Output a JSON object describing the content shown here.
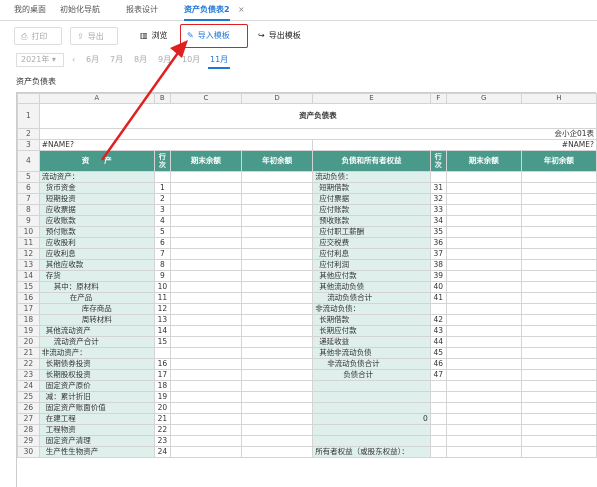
{
  "tabs": [
    {
      "label": "我的桌面"
    },
    {
      "label": "初始化导航"
    },
    {
      "label": "报表设计"
    },
    {
      "label": "资产负债表2"
    }
  ],
  "tab_close_glyph": "×",
  "toolbar": {
    "print": "打印",
    "export": "导出",
    "browse": "浏览",
    "import_template": "导入模板",
    "export_template": "导出模板"
  },
  "period": {
    "year": "2021年",
    "year_arrow": "▾",
    "prev": "‹",
    "months": [
      "6月",
      "7月",
      "8月",
      "9月",
      "10月",
      "11月"
    ],
    "active_month": "11月"
  },
  "sheet_name": "资产负债表",
  "columns": [
    "A",
    "B",
    "C",
    "D",
    "E",
    "F",
    "G",
    "H"
  ],
  "sheet": {
    "title": "资产负债表",
    "unit": "会小企01表",
    "ref_left": "#NAME?",
    "ref_right": "#NAME?",
    "headers": {
      "asset": "资　　产",
      "line_no": "行次",
      "end_balance": "期末余额",
      "begin_balance": "年初余额",
      "liab": "负债和所有者权益",
      "line_no2": "行次",
      "end_balance2": "期末余额",
      "begin_balance2": "年初余额"
    },
    "rows": [
      {
        "n": "5",
        "a": "流动资产：",
        "ai": 0,
        "b": "",
        "e": "流动负债：",
        "ei": 0,
        "f": ""
      },
      {
        "n": "6",
        "a": "货币资金",
        "ai": 1,
        "b": "1",
        "e": "短期借款",
        "ei": 1,
        "f": "31"
      },
      {
        "n": "7",
        "a": "短期投资",
        "ai": 1,
        "b": "2",
        "e": "应付票据",
        "ei": 1,
        "f": "32"
      },
      {
        "n": "8",
        "a": "应收票据",
        "ai": 1,
        "b": "3",
        "e": "应付账款",
        "ei": 1,
        "f": "33"
      },
      {
        "n": "9",
        "a": "应收账款",
        "ai": 1,
        "b": "4",
        "e": "预收账款",
        "ei": 1,
        "f": "34"
      },
      {
        "n": "10",
        "a": "预付账款",
        "ai": 1,
        "b": "5",
        "e": "应付职工薪酬",
        "ei": 1,
        "f": "35"
      },
      {
        "n": "11",
        "a": "应收股利",
        "ai": 1,
        "b": "6",
        "e": "应交税费",
        "ei": 1,
        "f": "36"
      },
      {
        "n": "12",
        "a": "应收利息",
        "ai": 1,
        "b": "7",
        "e": "应付利息",
        "ei": 1,
        "f": "37"
      },
      {
        "n": "13",
        "a": "其他应收款",
        "ai": 1,
        "b": "8",
        "e": "应付利润",
        "ei": 1,
        "f": "38"
      },
      {
        "n": "14",
        "a": "存货",
        "ai": 1,
        "b": "9",
        "e": "其他应付款",
        "ei": 1,
        "f": "39"
      },
      {
        "n": "15",
        "a": "其中：原材料",
        "ai": 2,
        "b": "10",
        "e": "其他流动负债",
        "ei": 1,
        "f": "40"
      },
      {
        "n": "16",
        "a": "在产品",
        "ai": 3,
        "b": "11",
        "e": "流动负债合计",
        "ei": 2,
        "f": "41"
      },
      {
        "n": "17",
        "a": "库存商品",
        "ai": 4,
        "b": "12",
        "e": "非流动负债：",
        "ei": 0,
        "f": ""
      },
      {
        "n": "18",
        "a": "周转材料",
        "ai": 4,
        "b": "13",
        "e": "长期借款",
        "ei": 1,
        "f": "42"
      },
      {
        "n": "19",
        "a": "其他流动资产",
        "ai": 1,
        "b": "14",
        "e": "长期应付款",
        "ei": 1,
        "f": "43"
      },
      {
        "n": "20",
        "a": "流动资产合计",
        "ai": 2,
        "b": "15",
        "e": "递延收益",
        "ei": 1,
        "f": "44"
      },
      {
        "n": "21",
        "a": "非流动资产：",
        "ai": 0,
        "b": "",
        "e": "其他非流动负债",
        "ei": 1,
        "f": "45"
      },
      {
        "n": "22",
        "a": "长期债券投资",
        "ai": 1,
        "b": "16",
        "e": "非流动负债合计",
        "ei": 2,
        "f": "46"
      },
      {
        "n": "23",
        "a": "长期股权投资",
        "ai": 1,
        "b": "17",
        "e": "负债合计",
        "ei": 3,
        "f": "47"
      },
      {
        "n": "24",
        "a": "固定资产原价",
        "ai": 1,
        "b": "18",
        "e": "",
        "ei": 0,
        "f": ""
      },
      {
        "n": "25",
        "a": "减：累计折旧",
        "ai": 1,
        "b": "19",
        "e": "",
        "ei": 0,
        "f": ""
      },
      {
        "n": "26",
        "a": "固定资产账面价值",
        "ai": 1,
        "b": "20",
        "e": "",
        "ei": 0,
        "f": ""
      },
      {
        "n": "27",
        "a": "在建工程",
        "ai": 1,
        "b": "21",
        "e": "",
        "ei": 0,
        "f": "",
        "e_val": "0"
      },
      {
        "n": "28",
        "a": "工程物资",
        "ai": 1,
        "b": "22",
        "e": "",
        "ei": 0,
        "f": ""
      },
      {
        "n": "29",
        "a": "固定资产清理",
        "ai": 1,
        "b": "23",
        "e": "",
        "ei": 0,
        "f": ""
      },
      {
        "n": "30",
        "a": "生产性生物资产",
        "ai": 1,
        "b": "24",
        "e": "所有者权益（或股东权益）：",
        "ei": 0,
        "f": ""
      }
    ]
  }
}
